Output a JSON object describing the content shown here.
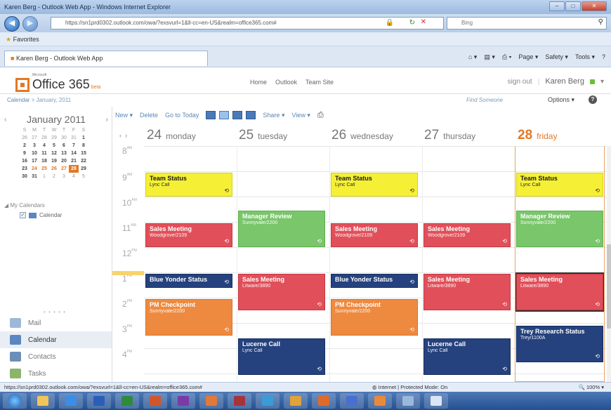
{
  "browser": {
    "title": "Karen Berg - Outlook Web App - Windows Internet Explorer",
    "url": "https://sn1prd0302.outlook.com/owa/?exsvurl=1&ll-cc=en-US&realm=office365.com#",
    "search_placeholder": "Bing",
    "favorites_label": "Favorites",
    "tab_title": "Karen Berg - Outlook Web App",
    "tools": [
      "Page ▾",
      "Safety ▾",
      "Tools ▾"
    ],
    "status_url": "https://sn1prd0302.outlook.com/owa/?exsvurl=1&ll-cc=en-US&realm=office365.com#",
    "status_zone": "Internet | Protected Mode: On",
    "status_zoom": "100%"
  },
  "header": {
    "logo_small": "Microsoft",
    "logo": "Office 365",
    "logo_beta": "beta",
    "nav": [
      "Home",
      "Outlook",
      "Team Site"
    ],
    "sign_out": "sign out",
    "user": "Karen Berg"
  },
  "breadcrumb": {
    "root": "Calendar",
    "sep": ">",
    "current": "January, 2011"
  },
  "find_someone": "Find Someone",
  "options_label": "Options ▾",
  "mini_calendar": {
    "month": "January 2011",
    "dow": [
      "S",
      "M",
      "T",
      "W",
      "T",
      "F",
      "S"
    ],
    "weeks": [
      [
        "26",
        "27",
        "28",
        "29",
        "30",
        "31",
        "1"
      ],
      [
        "2",
        "3",
        "4",
        "5",
        "6",
        "7",
        "8"
      ],
      [
        "9",
        "10",
        "11",
        "12",
        "13",
        "14",
        "15"
      ],
      [
        "16",
        "17",
        "18",
        "19",
        "20",
        "21",
        "22"
      ],
      [
        "23",
        "24",
        "25",
        "26",
        "27",
        "28",
        "29"
      ],
      [
        "30",
        "31",
        "1",
        "2",
        "3",
        "4",
        "5"
      ]
    ]
  },
  "my_calendars": {
    "heading": "My Calendars",
    "items": [
      "Calendar"
    ]
  },
  "modules": [
    "Mail",
    "Calendar",
    "Contacts",
    "Tasks"
  ],
  "toolbar": {
    "new": "New ▾",
    "delete": "Delete",
    "goto_today": "Go to Today",
    "share": "Share ▾",
    "view": "View ▾"
  },
  "days": [
    {
      "num": "24",
      "name": "monday"
    },
    {
      "num": "25",
      "name": "tuesday"
    },
    {
      "num": "26",
      "name": "wednesday"
    },
    {
      "num": "27",
      "name": "thursday"
    },
    {
      "num": "28",
      "name": "friday"
    }
  ],
  "hours": [
    {
      "h": "8",
      "ap": "AM"
    },
    {
      "h": "9",
      "ap": "AM"
    },
    {
      "h": "10",
      "ap": "AM"
    },
    {
      "h": "11",
      "ap": "AM"
    },
    {
      "h": "12",
      "ap": "PM"
    },
    {
      "h": "1",
      "ap": "PM"
    },
    {
      "h": "2",
      "ap": "PM"
    },
    {
      "h": "3",
      "ap": "PM"
    },
    {
      "h": "4",
      "ap": "PM"
    }
  ],
  "events": {
    "mon_team": {
      "title": "Team Status",
      "sub": "Lync Call"
    },
    "mon_sales": {
      "title": "Sales Meeting",
      "sub": "Woodgrove/2109"
    },
    "mon_blue": {
      "title": "Blue Yonder Status",
      "sub": ""
    },
    "mon_pm": {
      "title": "PM Checkpoint",
      "sub": "Sunnyvale/2200"
    },
    "tue_manager": {
      "title": "Manager Review",
      "sub": "Sunnyvale/2200"
    },
    "tue_sales": {
      "title": "Sales Meeting",
      "sub": "Litware/3890"
    },
    "tue_lucerne": {
      "title": "Lucerne Call",
      "sub": "Lync Call"
    },
    "wed_team": {
      "title": "Team Status",
      "sub": "Lync Call"
    },
    "wed_sales": {
      "title": "Sales Meeting",
      "sub": "Woodgrove/2109"
    },
    "wed_blue": {
      "title": "Blue Yonder Status",
      "sub": ""
    },
    "wed_pm": {
      "title": "PM Checkpoint",
      "sub": "Sunnyvale/2200"
    },
    "thu_sales1": {
      "title": "Sales Meeting",
      "sub": "Woodgrove/2109"
    },
    "thu_sales2": {
      "title": "Sales Meeting",
      "sub": "Litware/3890"
    },
    "thu_lucerne": {
      "title": "Lucerne Call",
      "sub": "Lync Call"
    },
    "fri_team": {
      "title": "Team Status",
      "sub": "Lync Call"
    },
    "fri_manager": {
      "title": "Manager Review",
      "sub": "Sunnyvale/2200"
    },
    "fri_sales": {
      "title": "Sales Meeting",
      "sub": "Litware/3890"
    },
    "fri_trey": {
      "title": "Trey Research Status",
      "sub": "Trey/1100A"
    }
  },
  "colors": {
    "accent": "#e37826",
    "yellow": "#f5f036",
    "green": "#79c66b",
    "red": "#e1505a",
    "orange": "#ee8a3f",
    "navy": "#25427e"
  }
}
